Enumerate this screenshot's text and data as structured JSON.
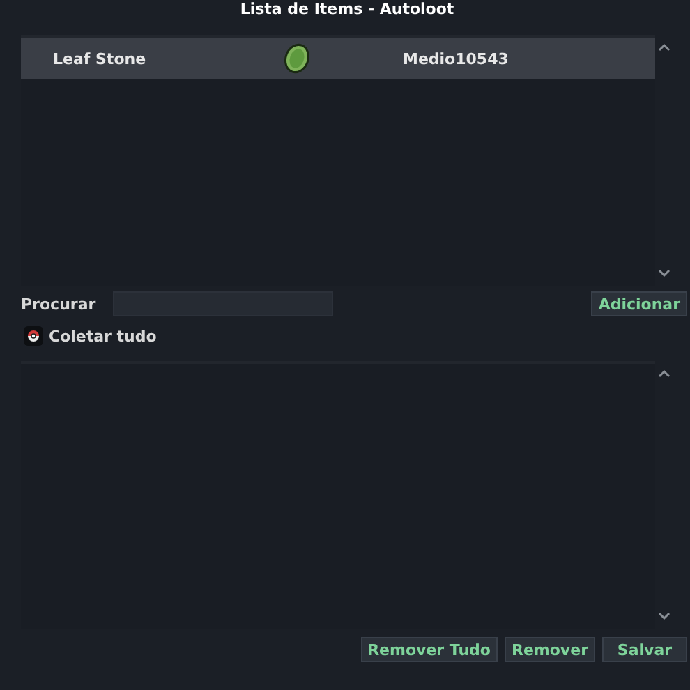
{
  "window": {
    "title": "Lista de Items - Autoloot"
  },
  "items": [
    {
      "name": "Leaf Stone",
      "owner": "Medio10543",
      "selected": true
    }
  ],
  "search": {
    "label": "Procurar"
  },
  "add_button": "Adicionar",
  "collect_all": {
    "label": "Coletar tudo",
    "checked": true
  },
  "buttons": [
    "Remover Tudo",
    "Remover",
    "Salvar"
  ]
}
